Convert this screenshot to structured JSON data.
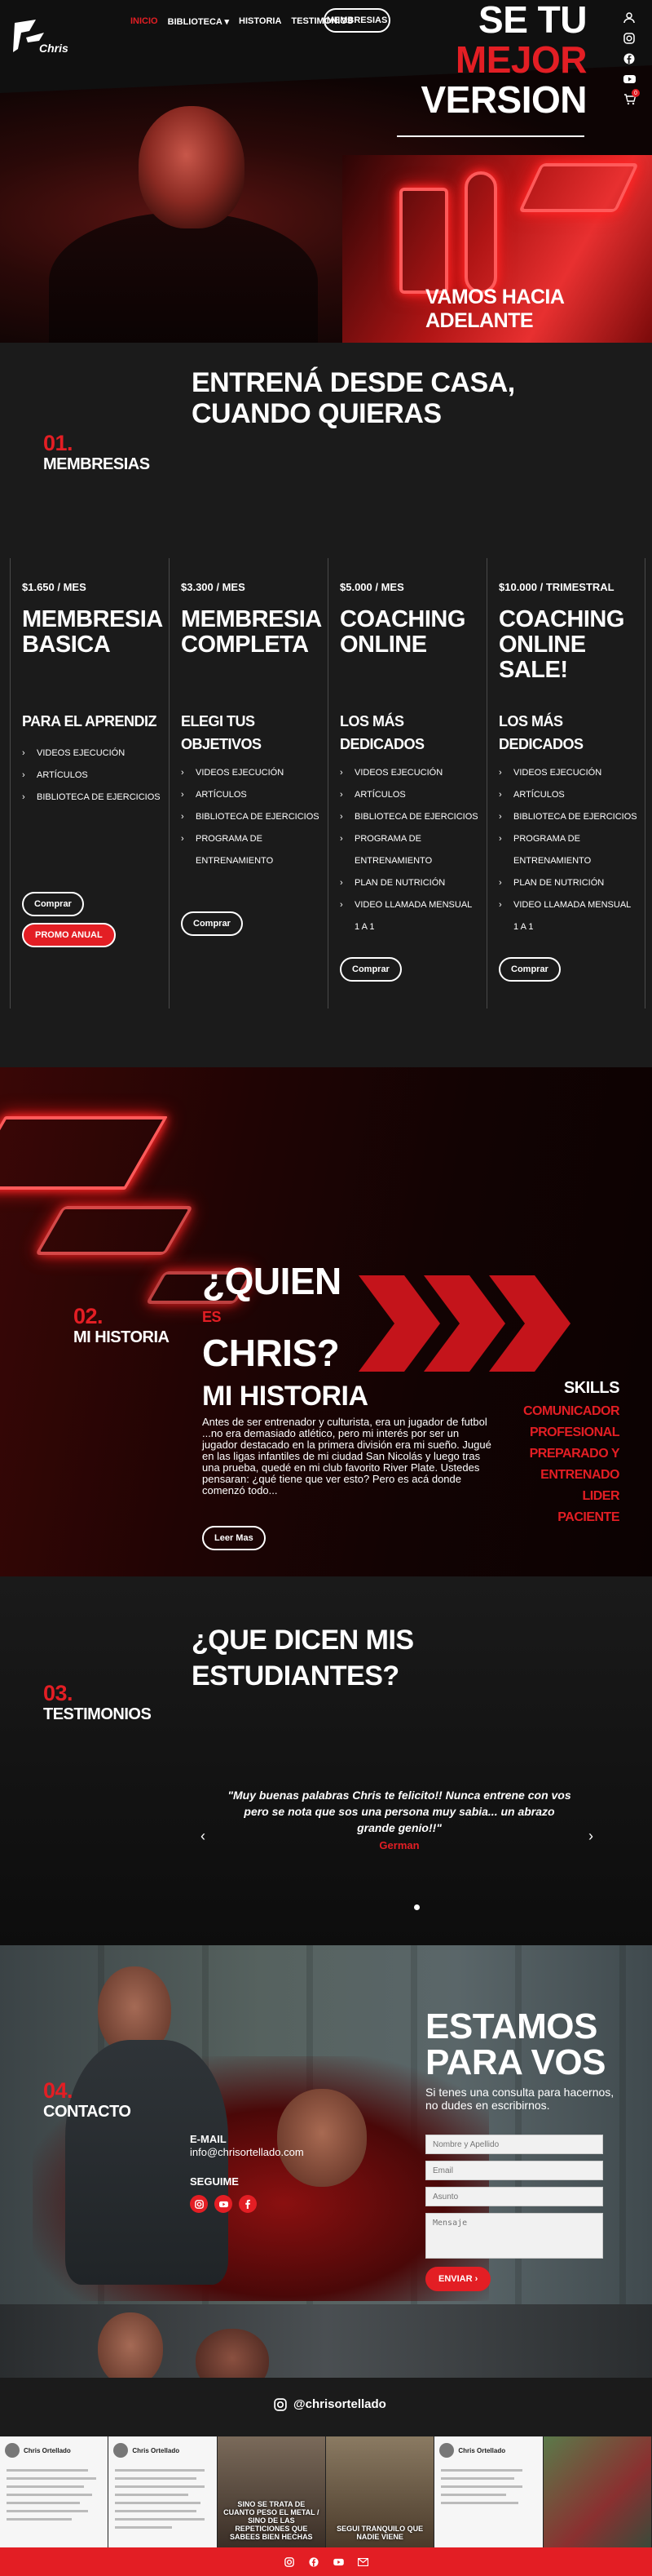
{
  "nav": {
    "items": [
      "INICIO",
      "BIBLIOTECA",
      "HISTORIA",
      "TESTIMONIOS"
    ],
    "active": "INICIO",
    "cta": "MEMBRESIAS"
  },
  "hero": {
    "title_l1": "SE TU",
    "title_l2": "MEJOR",
    "title_l3": "VERSION",
    "tagline": "VAMOS HACIA ADELANTE",
    "cart_count": "0",
    "logo_text": "Chris"
  },
  "sec1": {
    "title_l1": "ENTRENÁ DESDE CASA,",
    "title_l2": "CUANDO QUIERAS",
    "num": "01.",
    "label": "MEMBRESIAS"
  },
  "plans": [
    {
      "price": "$1.650 / MES",
      "name_l1": "MEMBRESIA",
      "name_l2": "BASICA",
      "name_l3": "",
      "aud_l1": "PARA EL APRENDIZ",
      "aud_l2": "",
      "features": [
        "VIDEOS EJECUCIÓN",
        "ARTÍCULOS",
        "BIBLIOTECA DE EJERCICIOS"
      ],
      "btn": "Comprar",
      "btn2": "PROMO ANUAL"
    },
    {
      "price": "$3.300 / MES",
      "name_l1": "MEMBRESIA",
      "name_l2": "COMPLETA",
      "name_l3": "",
      "aud_l1": "ELEGI TUS",
      "aud_l2": "OBJETIVOS",
      "features": [
        "VIDEOS EJECUCIÓN",
        "ARTÍCULOS",
        "BIBLIOTECA DE EJERCICIOS",
        "PROGRAMA DE ENTRENAMIENTO"
      ],
      "btn": "Comprar"
    },
    {
      "price": "$5.000 / MES",
      "name_l1": "COACHING",
      "name_l2": "ONLINE",
      "name_l3": "",
      "aud_l1": "LOS MÁS",
      "aud_l2": "DEDICADOS",
      "features": [
        "VIDEOS EJECUCIÓN",
        "ARTÍCULOS",
        "BIBLIOTECA DE EJERCICIOS",
        "PROGRAMA DE ENTRENAMIENTO",
        "PLAN DE NUTRICIÓN",
        "VIDEO LLAMADA MENSUAL 1 A 1"
      ],
      "btn": "Comprar"
    },
    {
      "price": "$10.000 / TRIMESTRAL",
      "name_l1": "COACHING",
      "name_l2": "ONLINE",
      "name_l3": "SALE!",
      "aud_l1": "LOS MÁS",
      "aud_l2": "DEDICADOS",
      "features": [
        "VIDEOS EJECUCIÓN",
        "ARTÍCULOS",
        "BIBLIOTECA DE EJERCICIOS",
        "PROGRAMA DE ENTRENAMIENTO",
        "PLAN DE NUTRICIÓN",
        "VIDEO LLAMADA MENSUAL 1 A 1"
      ],
      "btn": "Comprar"
    }
  ],
  "sec2": {
    "num": "02.",
    "label": "MI HISTORIA",
    "title_l1": "¿QUIEN",
    "title_es": "ES",
    "title_l2": "CHRIS?",
    "sub": "MI HISTORIA",
    "text": "Antes de ser entrenador y culturista, era un jugador de futbol ...no era demasiado atlético, pero mi interés por ser un jugador destacado en la primera división era mi sueño. Jugué en las ligas infantiles de mi ciudad San Nicolás y luego tras una prueba, quedé en mi club favorito River Plate. Ustedes pensaran: ¿qué tiene que ver esto? Pero es acá donde comenzó todo...",
    "btn": "Leer Mas",
    "skills_h": "SKILLS",
    "skills": [
      "COMUNICADOR",
      "PROFESIONAL",
      "PREPARADO Y",
      "ENTRENADO",
      "LIDER",
      "PACIENTE"
    ]
  },
  "sec3": {
    "title_l1": "¿QUE DICEN MIS",
    "title_l2": "ESTUDIANTES?",
    "num": "03.",
    "label": "TESTIMONIOS",
    "quote": "\"Muy buenas palabras Chris te felicito!! Nunca entrene con vos pero se nota que sos una persona muy sabia... un abrazo grande genio!!\"",
    "name": "German"
  },
  "sec4": {
    "num": "04.",
    "label": "CONTACTO",
    "title_l1": "ESTAMOS",
    "title_l2": "PARA VOS",
    "sub": "Si tenes una consulta para hacernos, no dudes en escribirnos.",
    "email_label": "E-MAIL",
    "email": "info@chrisortellado.com",
    "follow": "SEGUIME",
    "ph_name": "Nombre y Apellido",
    "ph_email": "Email",
    "ph_subject": "Asunto",
    "ph_msg": "Mensaje",
    "btn": "ENVIAR"
  },
  "instagram": {
    "handle": "@chrisortellado"
  },
  "feed": [
    {
      "user": "Chris Ortellado",
      "cap": ""
    },
    {
      "user": "Chris Ortellado",
      "cap": ""
    },
    {
      "user": "",
      "cap": "SINO SE TRATA DE CUANTO PESO EL METAL / SINO DE LAS REPETICIONES QUE SABEES BIEN HECHAS"
    },
    {
      "user": "",
      "cap": "SEGUI TRANQUILO QUE NADIE VIENE"
    },
    {
      "user": "Chris Ortellado",
      "cap": ""
    },
    {
      "user": "",
      "cap": ""
    }
  ]
}
